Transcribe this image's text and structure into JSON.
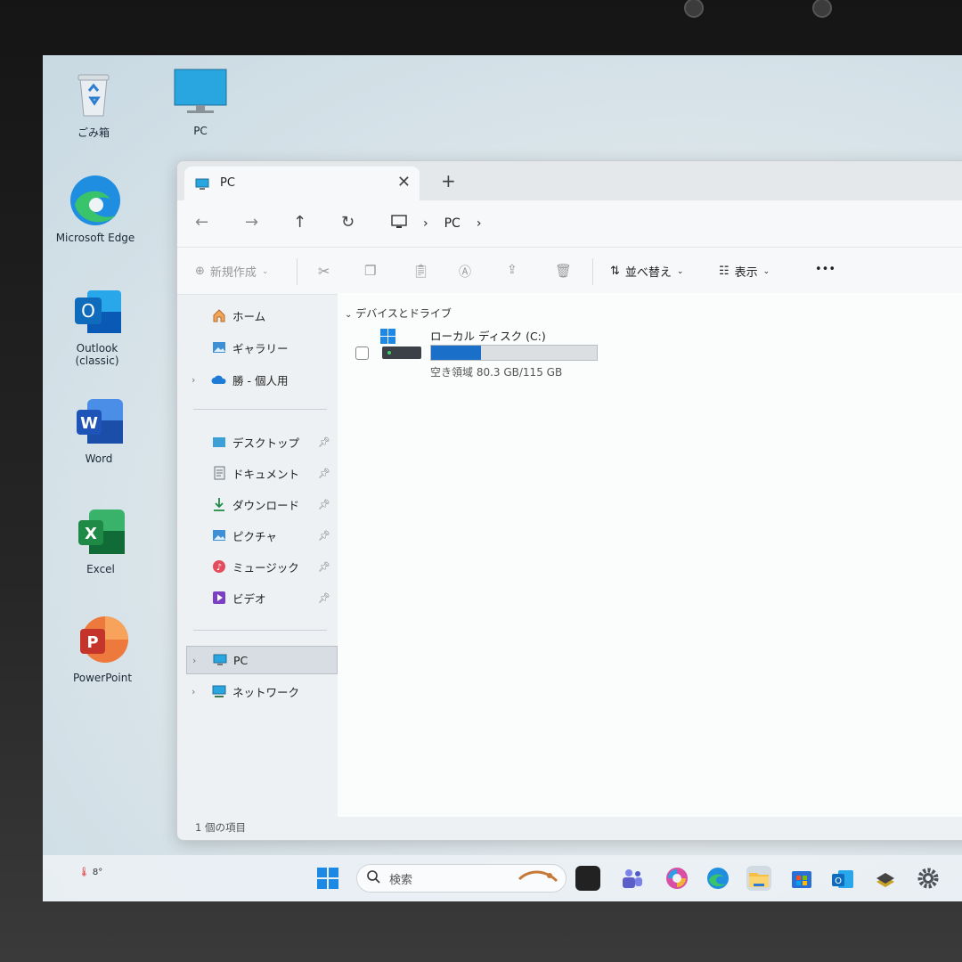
{
  "desktop": {
    "icons": [
      {
        "label": "ごみ箱",
        "icon": "recycle-bin-icon"
      },
      {
        "label": "PC",
        "icon": "pc-monitor-icon"
      },
      {
        "label": "Microsoft Edge",
        "icon": "edge-icon"
      },
      {
        "label": "Outlook (classic)",
        "icon": "outlook-icon"
      },
      {
        "label": "Word",
        "icon": "word-icon"
      },
      {
        "label": "Excel",
        "icon": "excel-icon"
      },
      {
        "label": "PowerPoint",
        "icon": "powerpoint-icon"
      }
    ]
  },
  "window": {
    "tab_title": "PC",
    "tab_close": "✕",
    "new_tab": "+",
    "address": {
      "segment": "PC",
      "sep": "›"
    },
    "toolbar": {
      "new_label": "新規作成",
      "sort_label": "並べ替え",
      "view_label": "表示",
      "more": "•••"
    },
    "sidebar": {
      "home": "ホーム",
      "gallery": "ギャラリー",
      "onedrive": "勝 - 個人用",
      "quick": [
        "デスクトップ",
        "ドキュメント",
        "ダウンロード",
        "ピクチャ",
        "ミュージック",
        "ビデオ"
      ],
      "pc": "PC",
      "network": "ネットワーク"
    },
    "content": {
      "group_label": "デバイスとドライブ",
      "drive_name": "ローカル ディスク (C:)",
      "drive_free": "空き領域 80.3 GB/115 GB",
      "drive_used_fraction": 0.302
    },
    "status": "1 個の項目"
  },
  "taskbar": {
    "search_placeholder": "検索",
    "weather": "8°"
  },
  "colors": {
    "accent": "#1a6fc9",
    "edge": "#1f8ee0",
    "word": "#2b5fbf",
    "excel": "#1f8a45",
    "powerpoint": "#d9472b",
    "outlook": "#0f6cbd"
  }
}
